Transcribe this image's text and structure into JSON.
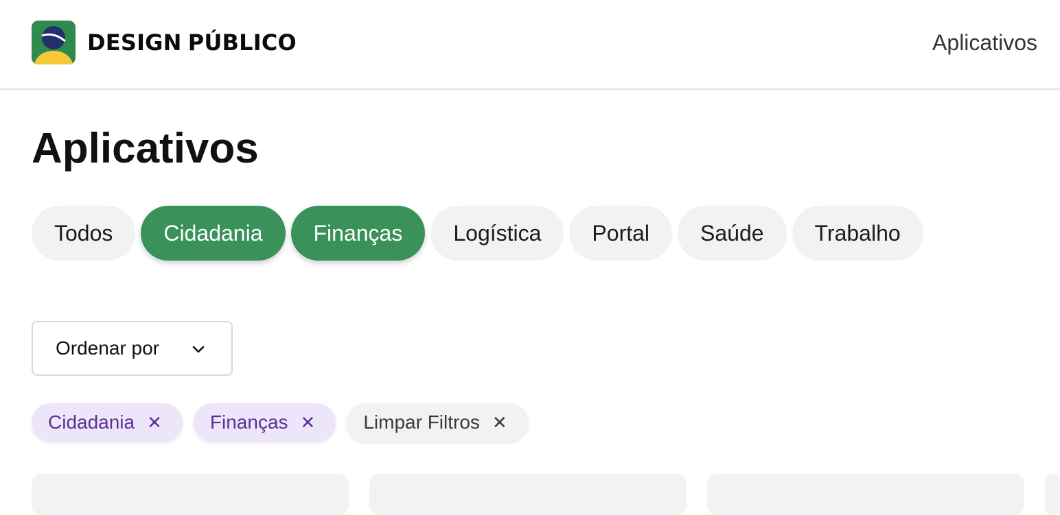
{
  "header": {
    "brand_part1": "DESIGN",
    "brand_part2": "PÚBLICO",
    "nav_link": "Aplicativos"
  },
  "main": {
    "title": "Aplicativos",
    "categories": [
      {
        "label": "Todos",
        "active": false
      },
      {
        "label": "Cidadania",
        "active": true
      },
      {
        "label": "Finanças",
        "active": true
      },
      {
        "label": "Logística",
        "active": false
      },
      {
        "label": "Portal",
        "active": false
      },
      {
        "label": "Saúde",
        "active": false
      },
      {
        "label": "Trabalho",
        "active": false
      }
    ],
    "sort": {
      "label": "Ordenar por",
      "icon": "chevron-down-icon"
    },
    "active_filters": [
      {
        "label": "Cidadania",
        "icon": "close-icon"
      },
      {
        "label": "Finanças",
        "icon": "close-icon"
      }
    ],
    "clear_filters": {
      "label": "Limpar Filtros",
      "icon": "close-icon"
    }
  },
  "colors": {
    "active_chip": "#3a915a",
    "inactive_chip": "#f1f2f4",
    "filter_tag_bg": "#ede5f9",
    "filter_tag_text": "#5c2f97",
    "logo_green": "#2f8a4e",
    "logo_blue": "#23306b",
    "logo_yellow": "#f7c838"
  }
}
